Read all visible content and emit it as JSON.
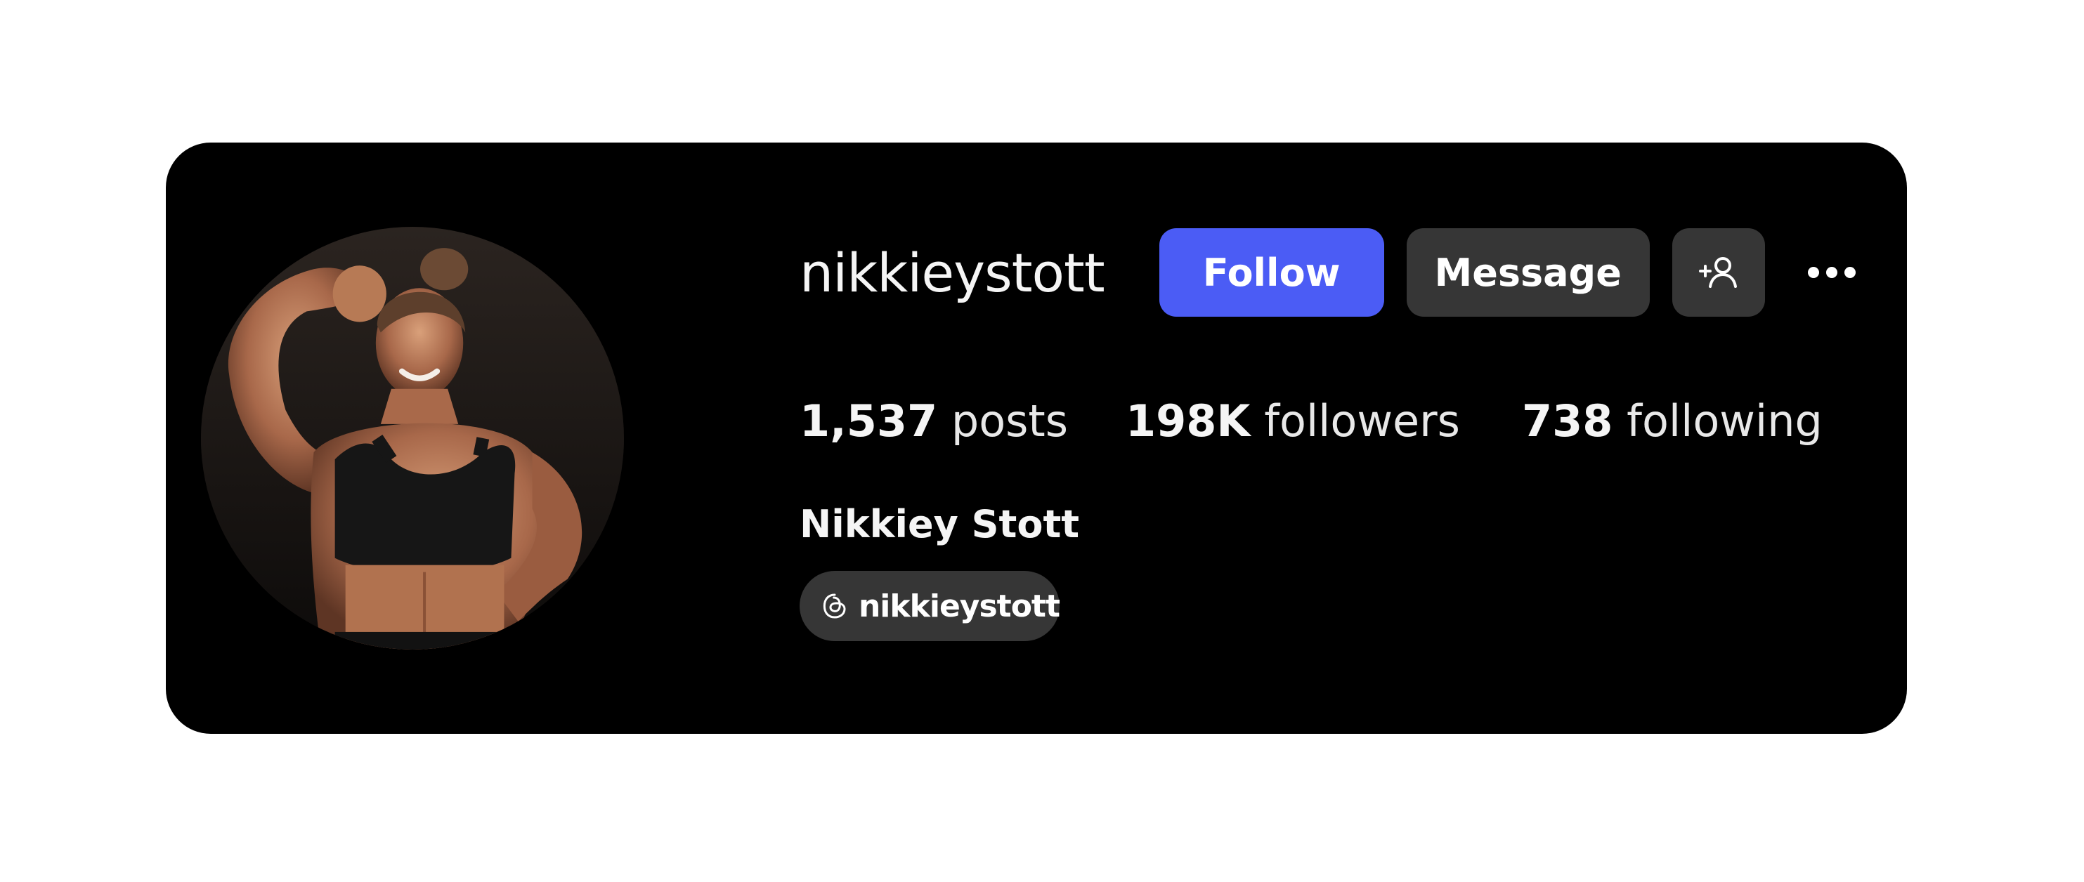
{
  "profile": {
    "username": "nikkieystott",
    "full_name": "Nikkiey Stott",
    "avatar_icon": "profile-photo"
  },
  "actions": {
    "follow_label": "Follow",
    "message_label": "Message",
    "add_friend_icon": "add-person-icon",
    "more_icon": "more-horizontal-icon"
  },
  "stats": {
    "posts": {
      "value": "1,537",
      "label": "posts"
    },
    "followers": {
      "value": "198K",
      "label": "followers"
    },
    "following": {
      "value": "738",
      "label": "following"
    }
  },
  "threads_link": {
    "icon": "threads-icon",
    "label": "nikkieystott"
  },
  "colors": {
    "card_background": "#000000",
    "follow_button": "#4b5cf5",
    "secondary_button": "#363636",
    "page_background": "#ffffff"
  }
}
